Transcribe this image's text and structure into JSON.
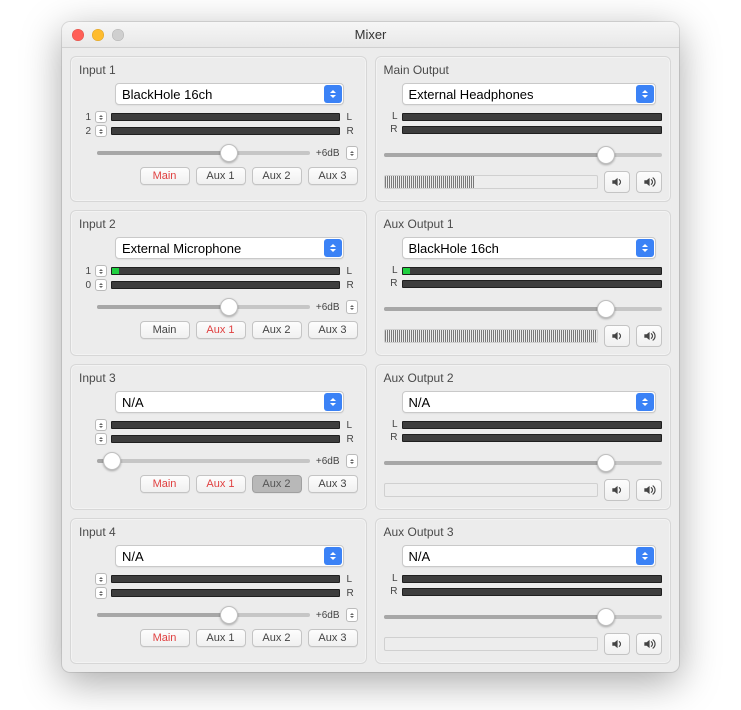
{
  "window": {
    "title": "Mixer"
  },
  "labels": {
    "gain": "+6dB"
  },
  "routing_labels": [
    "Main",
    "Aux 1",
    "Aux 2",
    "Aux 3"
  ],
  "inputs": [
    {
      "title": "Input 1",
      "device": "BlackHole 16ch",
      "channel_a": "1",
      "channel_b": "2",
      "label_a": "L",
      "label_b": "R",
      "meter_a": 0,
      "meter_b": 0,
      "slider": 62,
      "routing": [
        true,
        false,
        false,
        false
      ],
      "routing_pressed": [
        false,
        false,
        false,
        false
      ]
    },
    {
      "title": "Input 2",
      "device": "External Microphone",
      "channel_a": "1",
      "channel_b": "0",
      "label_a": "L",
      "label_b": "R",
      "meter_a": 3,
      "meter_b": 0,
      "slider": 62,
      "routing": [
        false,
        true,
        false,
        false
      ],
      "routing_pressed": [
        false,
        false,
        false,
        false
      ]
    },
    {
      "title": "Input 3",
      "device": "N/A",
      "channel_a": "",
      "channel_b": "",
      "label_a": "L",
      "label_b": "R",
      "meter_a": 0,
      "meter_b": 0,
      "slider": 7,
      "routing": [
        true,
        true,
        false,
        false
      ],
      "routing_pressed": [
        false,
        false,
        true,
        false
      ]
    },
    {
      "title": "Input 4",
      "device": "N/A",
      "channel_a": "",
      "channel_b": "",
      "label_a": "L",
      "label_b": "R",
      "meter_a": 0,
      "meter_b": 0,
      "slider": 62,
      "routing": [
        true,
        false,
        false,
        false
      ],
      "routing_pressed": [
        false,
        false,
        false,
        false
      ]
    }
  ],
  "outputs": [
    {
      "title": "Main Output",
      "device": "External Headphones",
      "label_a": "L",
      "label_b": "R",
      "meter_a": 0,
      "meter_b": 0,
      "slider": 80,
      "monitor": 42
    },
    {
      "title": "Aux Output 1",
      "device": "BlackHole 16ch",
      "label_a": "L",
      "label_b": "R",
      "meter_a": 3,
      "meter_b": 0,
      "slider": 80,
      "monitor": 100
    },
    {
      "title": "Aux Output 2",
      "device": "N/A",
      "label_a": "L",
      "label_b": "R",
      "meter_a": 0,
      "meter_b": 0,
      "slider": 80,
      "monitor": 0
    },
    {
      "title": "Aux Output 3",
      "device": "N/A",
      "label_a": "L",
      "label_b": "R",
      "meter_a": 0,
      "meter_b": 0,
      "slider": 80,
      "monitor": 0
    }
  ]
}
